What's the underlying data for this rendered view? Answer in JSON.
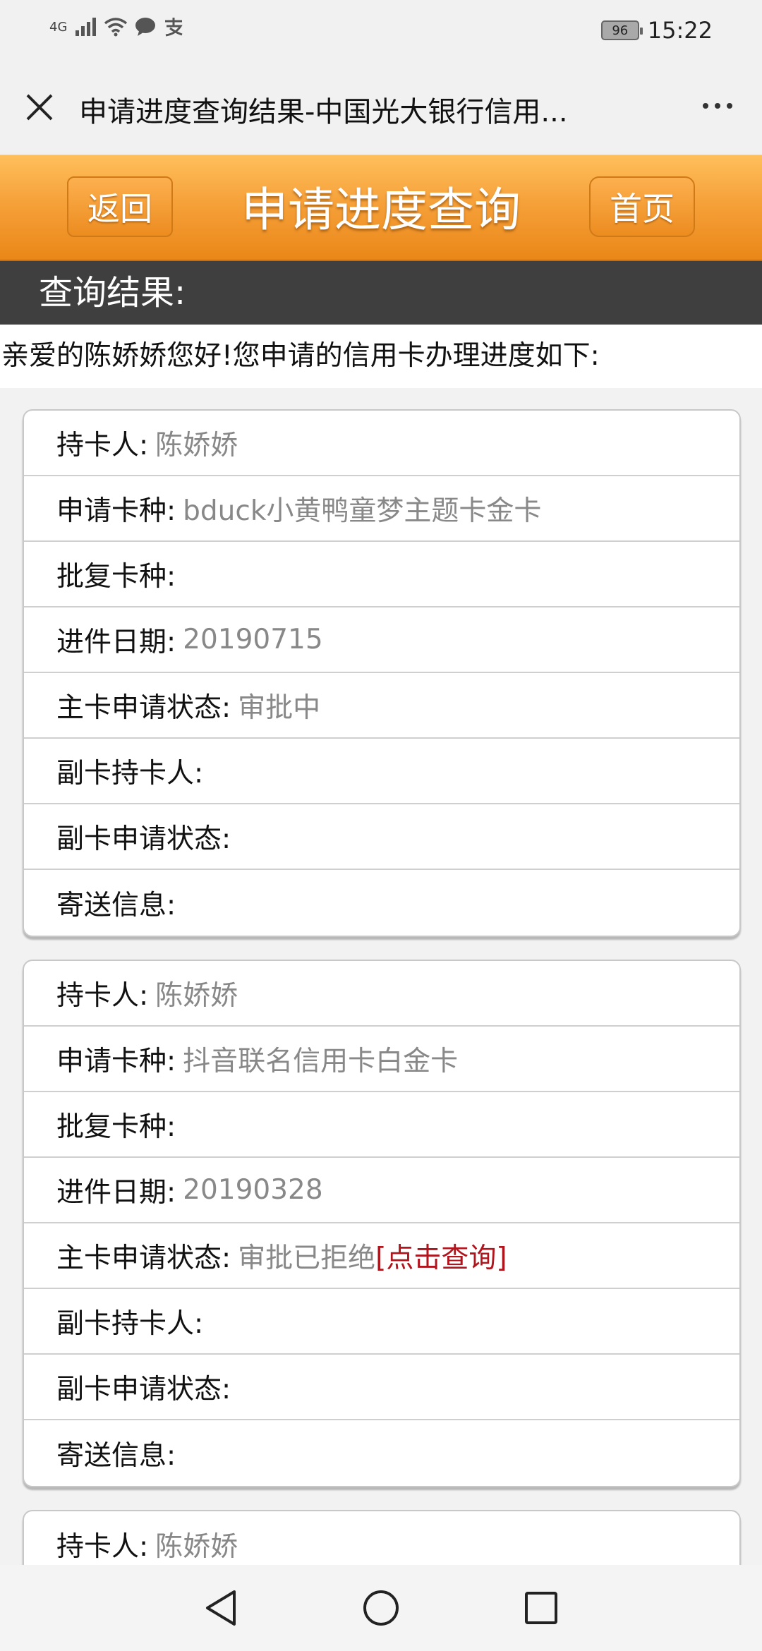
{
  "status_bar": {
    "network": "4G",
    "battery": "96",
    "time": "15:22"
  },
  "title_bar": {
    "title": "申请进度查询结果-中国光大银行信用..."
  },
  "header": {
    "back_label": "返回",
    "title": "申请进度查询",
    "home_label": "首页"
  },
  "section": {
    "title": "查询结果:",
    "greeting": "亲爱的陈娇娇您好!您申请的信用卡办理进度如下:"
  },
  "cards": [
    {
      "rows": [
        {
          "label": "持卡人:",
          "value": "陈娇娇"
        },
        {
          "label": "申请卡种:",
          "value": "bduck小黄鸭童梦主题卡金卡"
        },
        {
          "label": "批复卡种:",
          "value": ""
        },
        {
          "label": "进件日期:",
          "value": "20190715"
        },
        {
          "label": "主卡申请状态:",
          "value": "审批中"
        },
        {
          "label": "副卡持卡人:",
          "value": ""
        },
        {
          "label": "副卡申请状态:",
          "value": ""
        },
        {
          "label": "寄送信息:",
          "value": ""
        }
      ]
    },
    {
      "rows": [
        {
          "label": "持卡人:",
          "value": "陈娇娇"
        },
        {
          "label": "申请卡种:",
          "value": "抖音联名信用卡白金卡"
        },
        {
          "label": "批复卡种:",
          "value": ""
        },
        {
          "label": "进件日期:",
          "value": "20190328"
        },
        {
          "label": "主卡申请状态:",
          "value": "审批已拒绝",
          "link": "[点击查询]"
        },
        {
          "label": "副卡持卡人:",
          "value": ""
        },
        {
          "label": "副卡申请状态:",
          "value": ""
        },
        {
          "label": "寄送信息:",
          "value": ""
        }
      ]
    },
    {
      "rows": [
        {
          "label": "持卡人:",
          "value": "陈娇娇"
        }
      ]
    }
  ],
  "colors": {
    "header_orange": "#f6a13a",
    "section_dark": "#3f3f3f",
    "value_gray": "#888888",
    "link_red": "#b0141c"
  },
  "icons": {
    "close": "close-icon",
    "more": "more-icon",
    "back": "nav-back-icon",
    "home": "nav-home-icon",
    "recents": "nav-recents-icon"
  }
}
